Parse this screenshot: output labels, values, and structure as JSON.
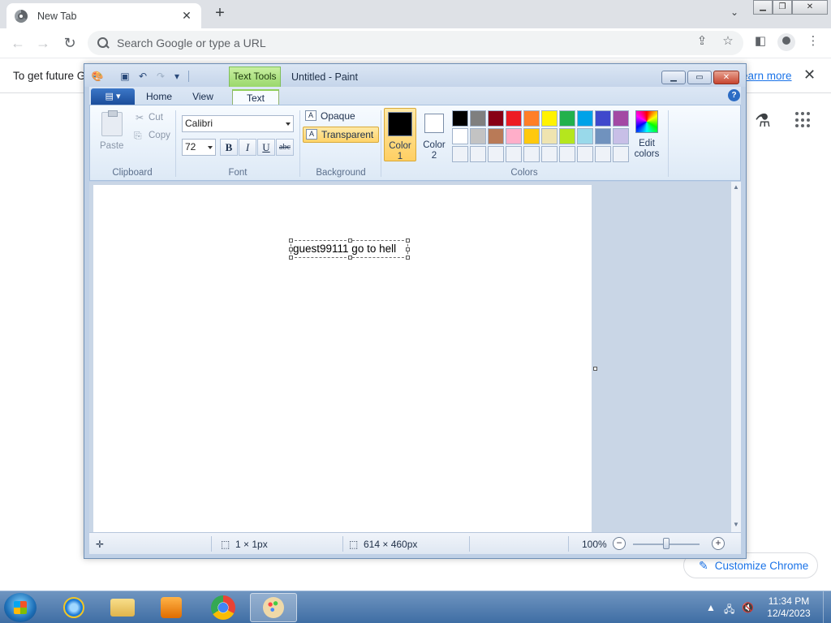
{
  "chrome": {
    "tab_title": "New Tab",
    "omnibox_placeholder": "Search Google or type a URL",
    "infobar_text": "To get future G",
    "infobar_link": "earn more",
    "customize_label": "Customize Chrome",
    "icons": {
      "back": "back-arrow-icon",
      "forward": "forward-arrow-icon",
      "reload": "reload-icon",
      "share": "share-icon",
      "bookmark": "star-icon",
      "side_panel": "side-panel-icon",
      "profile": "profile-avatar",
      "menu": "kebab-menu-icon",
      "labs": "labs-flask-icon",
      "apps": "apps-grid-icon"
    }
  },
  "paint": {
    "title": "Untitled - Paint",
    "context_tab": "Text Tools",
    "tabs": [
      "Home",
      "View",
      "Text"
    ],
    "active_tab": "Text",
    "clipboard": {
      "paste": "Paste",
      "cut": "Cut",
      "copy": "Copy",
      "group_label": "Clipboard"
    },
    "font": {
      "family": "Calibri",
      "size": "72",
      "bold": "B",
      "italic": "I",
      "underline": "U",
      "strike": "abc",
      "group_label": "Font"
    },
    "background": {
      "opaque": "Opaque",
      "transparent": "Transparent",
      "selected": "Transparent",
      "group_label": "Background"
    },
    "colors": {
      "color1_label": "Color 1",
      "color1_l1": "Color",
      "color1_l2": "1",
      "color2_l1": "Color",
      "color2_l2": "2",
      "color1": "#000000",
      "color2": "#ffffff",
      "edit_l1": "Edit",
      "edit_l2": "colors",
      "group_label": "Colors",
      "palette_row1": [
        "#000000",
        "#7f7f7f",
        "#880015",
        "#ed1c24",
        "#ff7f27",
        "#fff200",
        "#22b14c",
        "#00a2e8",
        "#3f48cc",
        "#a349a4"
      ],
      "palette_row2": [
        "#ffffff",
        "#c3c3c3",
        "#b97a57",
        "#ffaec9",
        "#ffc90e",
        "#efe4b0",
        "#b5e61d",
        "#99d9ea",
        "#7092be",
        "#c8bfe7"
      ]
    },
    "canvas_text": "guest99111 go to hell",
    "status": {
      "selection_size": "1 × 1px",
      "canvas_size": "614 × 460px",
      "zoom": "100%"
    }
  },
  "taskbar": {
    "apps": [
      "internet-explorer",
      "windows-explorer",
      "media-player",
      "google-chrome",
      "paint"
    ],
    "active_app": "paint",
    "time": "11:34 PM",
    "date": "12/4/2023"
  }
}
